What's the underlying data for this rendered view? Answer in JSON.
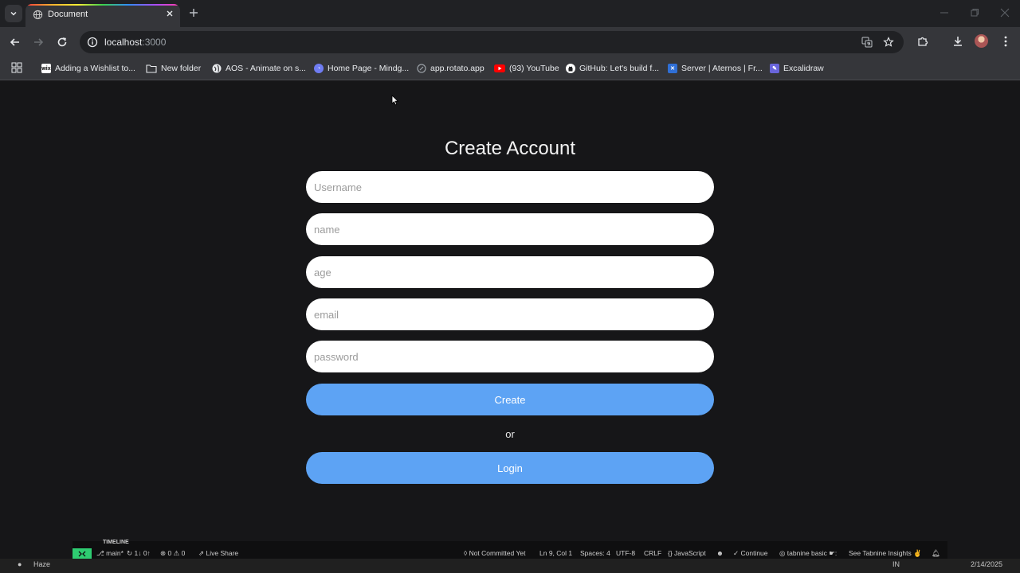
{
  "browser": {
    "tab_title": "Document",
    "url_host": "localhost",
    "url_port": ":3000",
    "bookmarks": [
      {
        "label": "Adding a Wishlist to...",
        "icon": "wix-icon",
        "color": "#222222"
      },
      {
        "label": "New folder",
        "icon": "folder-icon",
        "color": "#e8eaed"
      },
      {
        "label": "AOS - Animate on s...",
        "icon": "globe-icon",
        "color": "#e8eaed"
      },
      {
        "label": "Home Page - Mindg...",
        "icon": "mindgrasp-icon",
        "color": "#6f7cf2"
      },
      {
        "label": "app.rotato.app",
        "icon": "rotato-icon",
        "color": "#9aa0a6"
      },
      {
        "label": "(93) YouTube",
        "icon": "youtube-icon",
        "color": "#ff0000"
      },
      {
        "label": "GitHub: Let's build f...",
        "icon": "github-icon",
        "color": "#ffffff"
      },
      {
        "label": "Server | Aternos | Fr...",
        "icon": "aternos-icon",
        "color": "#2f6fd6"
      },
      {
        "label": "Excalidraw",
        "icon": "excalidraw-icon",
        "color": "#6965db"
      }
    ]
  },
  "form": {
    "title": "Create Account",
    "fields": {
      "username": "Username",
      "name": "name",
      "age": "age",
      "email": "email",
      "password": "password"
    },
    "create_label": "Create",
    "or_label": "or",
    "login_label": "Login",
    "button_color": "#5da3f4"
  },
  "vscode_status": {
    "timeline": "TIMELINE",
    "branch": "main*",
    "sync": "1↓ 0↑",
    "problems": "0",
    "warnings": "0",
    "live_share": "Live Share",
    "not_committed": "Not Committed Yet",
    "cursor_pos": "Ln 9, Col 1",
    "spaces": "Spaces: 4",
    "encoding": "UTF-8",
    "line_ending": "CRLF",
    "language": "JavaScript",
    "continue": "Continue",
    "tabnine": "tabnine basic",
    "insights": "See Tabnine Insights"
  },
  "taskbar": {
    "weather": "Haze",
    "lang": "IN",
    "date": "2/14/2025"
  }
}
